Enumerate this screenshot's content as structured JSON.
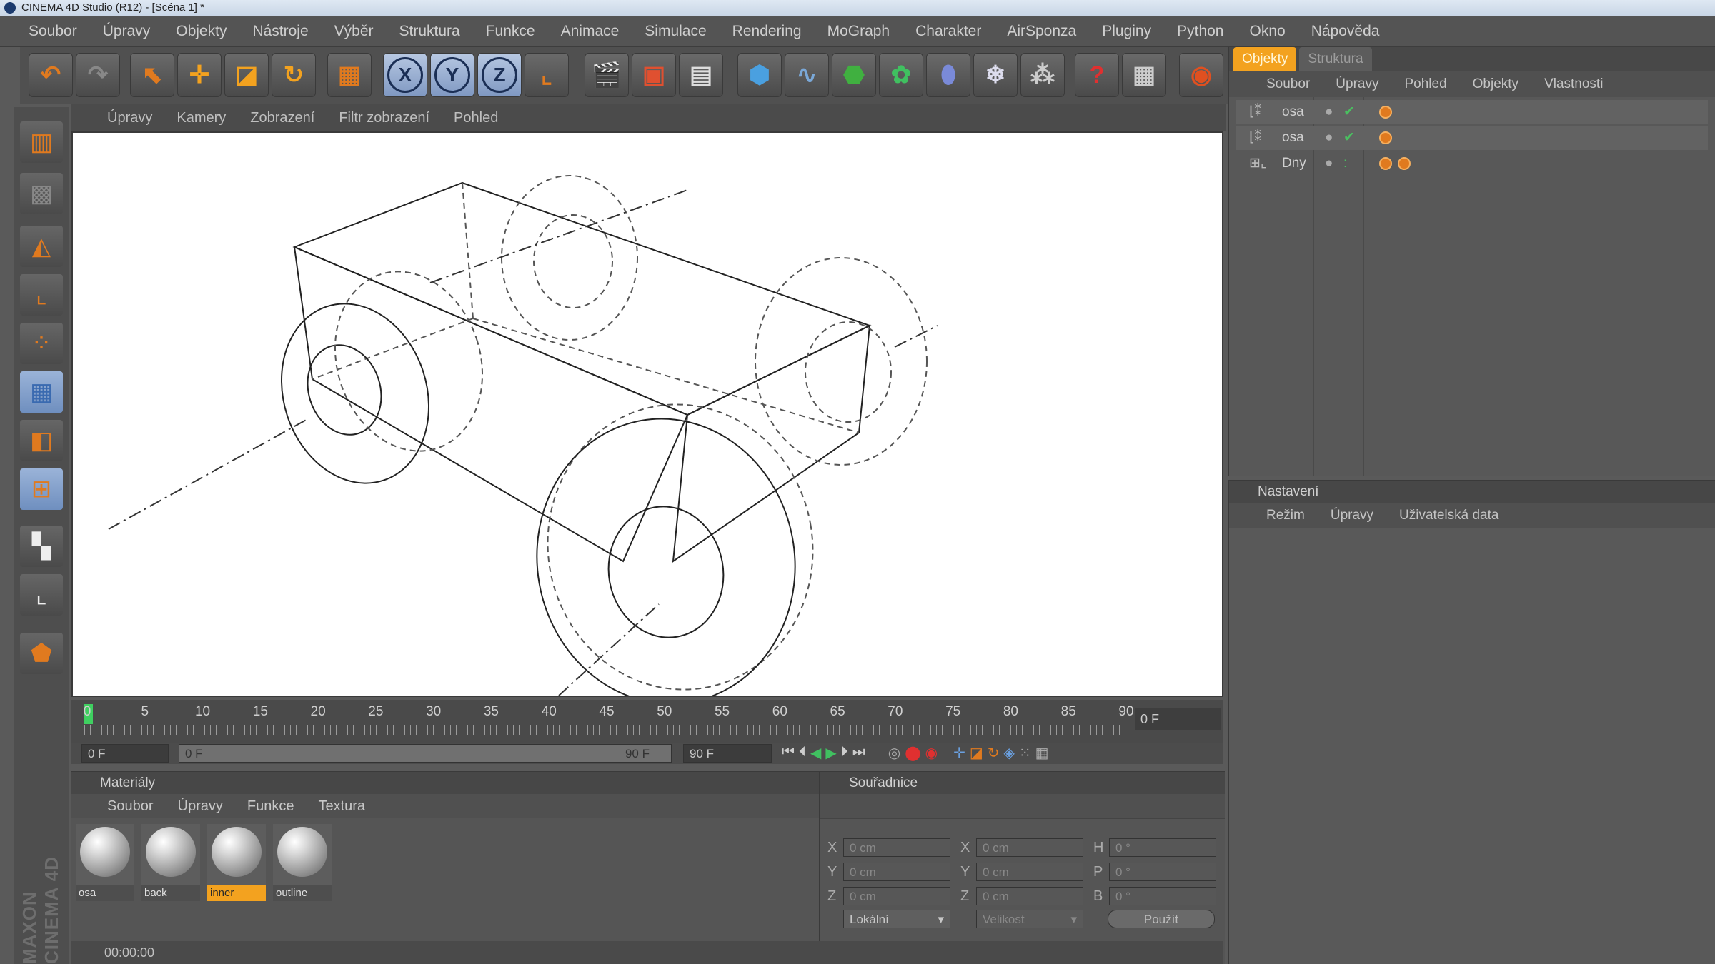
{
  "window": {
    "title": "CINEMA 4D Studio (R12) - [Scéna 1] *"
  },
  "menu": [
    "Soubor",
    "Úpravy",
    "Objekty",
    "Nástroje",
    "Výběr",
    "Struktura",
    "Funkce",
    "Animace",
    "Simulace",
    "Rendering",
    "MoGraph",
    "Charakter",
    "AirSponza",
    "Pluginy",
    "Python",
    "Okno",
    "Nápověda"
  ],
  "toolbar": {
    "axis_x": "X",
    "axis_y": "Y",
    "axis_z": "Z"
  },
  "viewport": {
    "menu": [
      "Úpravy",
      "Kamery",
      "Zobrazení",
      "Filtr zobrazení",
      "Pohled"
    ]
  },
  "timeline": {
    "ticks": [
      "0",
      "5",
      "10",
      "15",
      "20",
      "25",
      "30",
      "35",
      "40",
      "45",
      "50",
      "55",
      "60",
      "65",
      "70",
      "75",
      "80",
      "85",
      "90"
    ],
    "current_frame": "0 F",
    "start_field": "0 F",
    "range_start": "0 F",
    "range_end": "90 F",
    "end_field": "90 F"
  },
  "materials": {
    "title": "Materiály",
    "menu": [
      "Soubor",
      "Úpravy",
      "Funkce",
      "Textura"
    ],
    "items": [
      {
        "name": "osa",
        "selected": false
      },
      {
        "name": "back",
        "selected": false
      },
      {
        "name": "inner",
        "selected": true
      },
      {
        "name": "outline",
        "selected": false
      }
    ]
  },
  "coordinates": {
    "title": "Souřadnice",
    "rows": [
      {
        "axis": "X",
        "pos": "0 cm",
        "size_axis": "X",
        "size": "0 cm",
        "rot_axis": "H",
        "rot": "0 °"
      },
      {
        "axis": "Y",
        "pos": "0 cm",
        "size_axis": "Y",
        "size": "0 cm",
        "rot_axis": "P",
        "rot": "0 °"
      },
      {
        "axis": "Z",
        "pos": "0 cm",
        "size_axis": "Z",
        "size": "0 cm",
        "rot_axis": "B",
        "rot": "0 °"
      }
    ],
    "mode_select": "Lokální",
    "size_select": "Velikost",
    "apply_button": "Použít"
  },
  "status": {
    "time": "00:00:00"
  },
  "objects_panel": {
    "tabs": [
      "Objekty",
      "Struktura"
    ],
    "menu": [
      "Soubor",
      "Úpravy",
      "Pohled",
      "Objekty",
      "Vlastnosti"
    ],
    "rows": [
      {
        "name": "osa"
      },
      {
        "name": "osa"
      },
      {
        "name": "Dny"
      }
    ]
  },
  "attributes_panel": {
    "title": "Nastavení",
    "menu": [
      "Režim",
      "Úpravy",
      "Uživatelská data"
    ]
  }
}
